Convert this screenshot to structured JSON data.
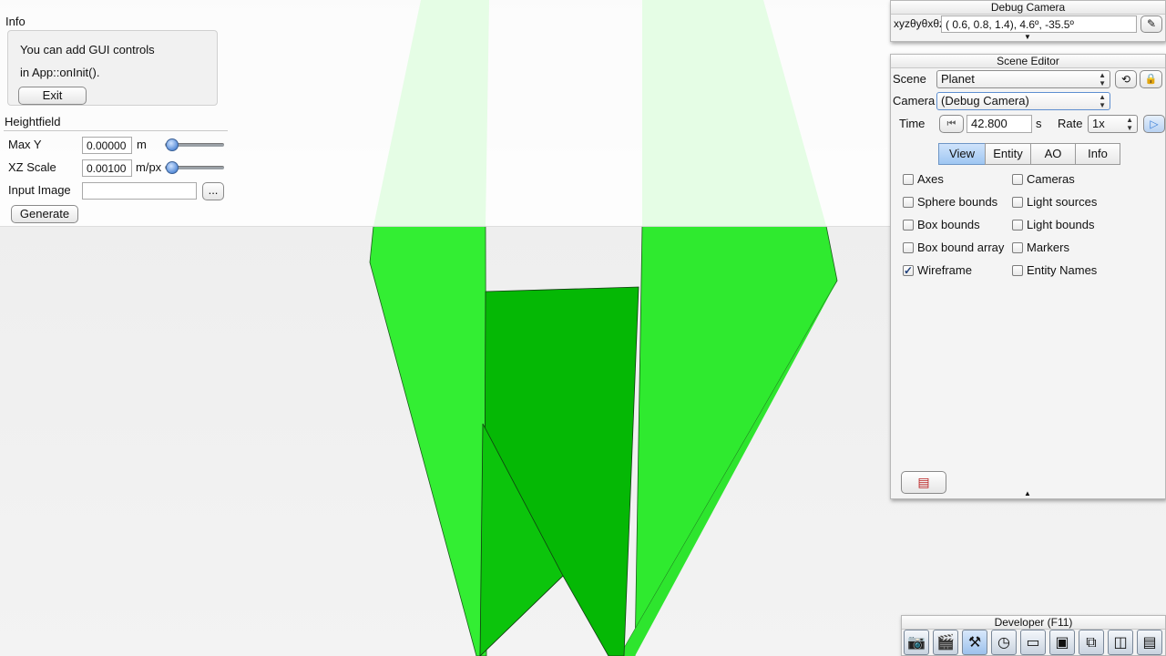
{
  "info": {
    "title": "Info",
    "message_line1": "You can add GUI controls",
    "message_line2": "in App::onInit().",
    "exit_label": "Exit"
  },
  "heightfield": {
    "title": "Heightfield",
    "max_y": {
      "label": "Max Y",
      "value": "0.00000",
      "unit": "m",
      "slider_fraction": 0.0
    },
    "xz_scale": {
      "label": "XZ Scale",
      "value": "0.00100",
      "unit": "m/px",
      "slider_fraction": 0.0
    },
    "input_image": {
      "label": "Input Image",
      "value": "",
      "browse_label": "..."
    },
    "generate_label": "Generate"
  },
  "debug_camera": {
    "title": "Debug Camera",
    "coord_label": "xyzθyθxθz",
    "coord_value": "(  0.6,    0.8,    1.4),    4.6º, -35.5º"
  },
  "scene_editor": {
    "title": "Scene Editor",
    "scene_label": "Scene",
    "scene_value": "Planet",
    "camera_label": "Camera",
    "camera_value": "(Debug Camera)",
    "time_label": "Time",
    "time_value": "42.800",
    "time_unit": "s",
    "rate_label": "Rate",
    "rate_value": "1x",
    "tabs": [
      "View",
      "Entity",
      "AO",
      "Info"
    ],
    "active_tab": "View",
    "checkboxes": [
      {
        "label": "Axes",
        "checked": false
      },
      {
        "label": "Sphere bounds",
        "checked": false
      },
      {
        "label": "Box bounds",
        "checked": false
      },
      {
        "label": "Box bound array",
        "checked": false
      },
      {
        "label": "Wireframe",
        "checked": true
      },
      {
        "label": "Cameras",
        "checked": false
      },
      {
        "label": "Light sources",
        "checked": false
      },
      {
        "label": "Light bounds",
        "checked": false
      },
      {
        "label": "Markers",
        "checked": false
      },
      {
        "label": "Entity Names",
        "checked": false
      }
    ]
  },
  "developer": {
    "title": "Developer (F11)",
    "icons": [
      "camera-icon",
      "film-clapper-icon",
      "tools-icon",
      "clock-icon",
      "notes-icon",
      "terminal-icon",
      "windows-icon",
      "profiler-icon",
      "document-icon"
    ]
  },
  "colors": {
    "green_light": "#3ff03f",
    "green_dark": "#00bf00",
    "tab_active": "#a9cdf4"
  }
}
